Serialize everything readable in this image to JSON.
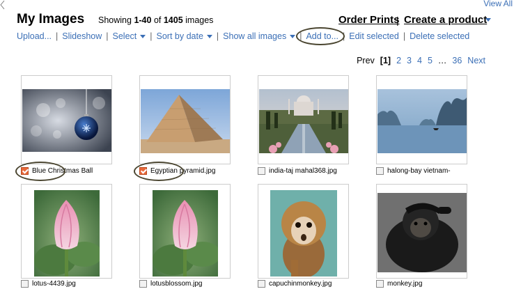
{
  "header": {
    "view_all": "View All",
    "title": "My Images",
    "showing_prefix": "Showing ",
    "showing_range": "1-40",
    "showing_of": " of ",
    "showing_total": "1405",
    "showing_suffix": " images",
    "order_prints": "Order Prints",
    "separator": "|",
    "create_product": "Create a product"
  },
  "toolbar": {
    "items": [
      {
        "label": "Upload...",
        "dropdown": false
      },
      {
        "label": "Slideshow",
        "dropdown": false
      },
      {
        "label": "Select",
        "dropdown": true
      },
      {
        "label": "Sort by date",
        "dropdown": true
      },
      {
        "label": "Show all images",
        "dropdown": true
      },
      {
        "label": "Add to...",
        "dropdown": false
      },
      {
        "label": "Edit selected",
        "dropdown": false
      },
      {
        "label": "Delete selected",
        "dropdown": false
      }
    ],
    "separator": "|"
  },
  "pager": {
    "prev": "Prev",
    "current": "[1]",
    "pages": [
      "2",
      "3",
      "4",
      "5"
    ],
    "ellipsis": "…",
    "last": "36",
    "next": "Next"
  },
  "images": [
    {
      "caption": "Blue Christmas Ball",
      "checked": true,
      "icon": "christmas-ornament"
    },
    {
      "caption": "Egyptian pyramid.jpg",
      "checked": true,
      "icon": "pyramid"
    },
    {
      "caption": "india-taj mahal368.jpg",
      "checked": false,
      "icon": "taj-mahal"
    },
    {
      "caption": "halong-bay vietnam-",
      "checked": false,
      "icon": "halong-bay"
    },
    {
      "caption": "lotus-4439.jpg",
      "checked": false,
      "icon": "lotus"
    },
    {
      "caption": "lotusblossom.jpg",
      "checked": false,
      "icon": "lotus"
    },
    {
      "caption": "capuchinmonkey.jpg",
      "checked": false,
      "icon": "monkey"
    },
    {
      "caption": "monkey.jpg",
      "checked": false,
      "icon": "chimpanzee"
    }
  ],
  "colors": {
    "link": "#3b6fb6",
    "checkbox_checked": "#e8683a",
    "annotation_oval": "#4a4530"
  }
}
